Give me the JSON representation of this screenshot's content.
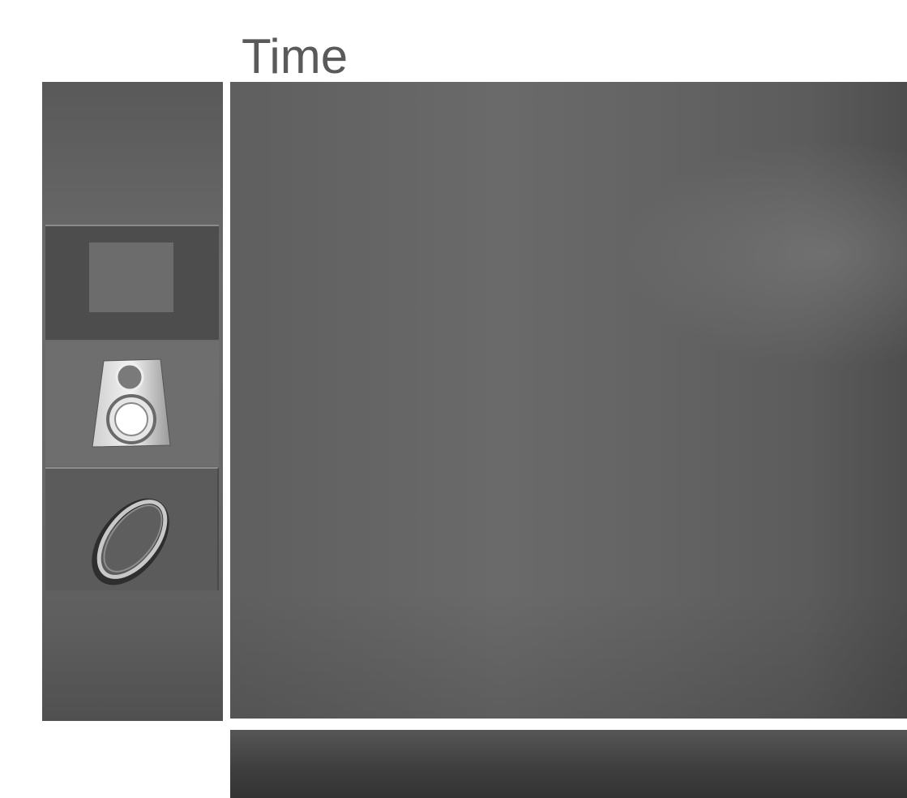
{
  "menu": {
    "title": "Time",
    "items": [
      {
        "name": "picture",
        "icon": "picture-icon"
      },
      {
        "name": "sound",
        "icon": "speaker-icon"
      },
      {
        "name": "time",
        "icon": "clock-icon",
        "selected": true
      }
    ]
  }
}
